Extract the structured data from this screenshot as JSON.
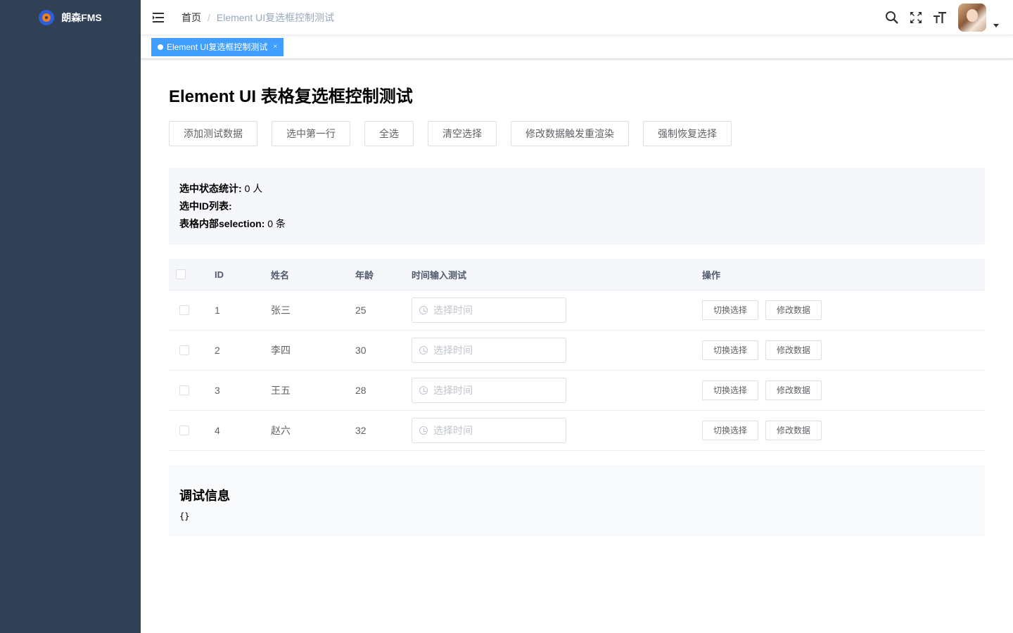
{
  "sidebar": {
    "logo_title": "朗森FMS"
  },
  "navbar": {
    "breadcrumb": {
      "home": "首页",
      "current": "Element UI复选框控制测试"
    }
  },
  "tags": [
    {
      "label": "Element UI复选框控制测试",
      "close": "×"
    }
  ],
  "page": {
    "title": "Element UI 表格复选框控制测试",
    "buttons": [
      "添加测试数据",
      "选中第一行",
      "全选",
      "清空选择",
      "修改数据触发重渲染",
      "强制恢复选择"
    ]
  },
  "status": {
    "count_label": "选中状态统计:",
    "count_value": "0 人",
    "ids_label": "选中ID列表:",
    "ids_value": "",
    "selection_label": "表格内部selection:",
    "selection_value": "0 条"
  },
  "table": {
    "headers": {
      "id": "ID",
      "name": "姓名",
      "age": "年龄",
      "time": "时间输入测试",
      "op": "操作"
    },
    "time_placeholder": "选择时间",
    "toggle_label": "切换选择",
    "edit_label": "修改数据",
    "rows": [
      {
        "id": "1",
        "name": "张三",
        "age": "25"
      },
      {
        "id": "2",
        "name": "李四",
        "age": "30"
      },
      {
        "id": "3",
        "name": "王五",
        "age": "28"
      },
      {
        "id": "4",
        "name": "赵六",
        "age": "32"
      }
    ]
  },
  "debug": {
    "title": "调试信息",
    "content": "{}"
  }
}
